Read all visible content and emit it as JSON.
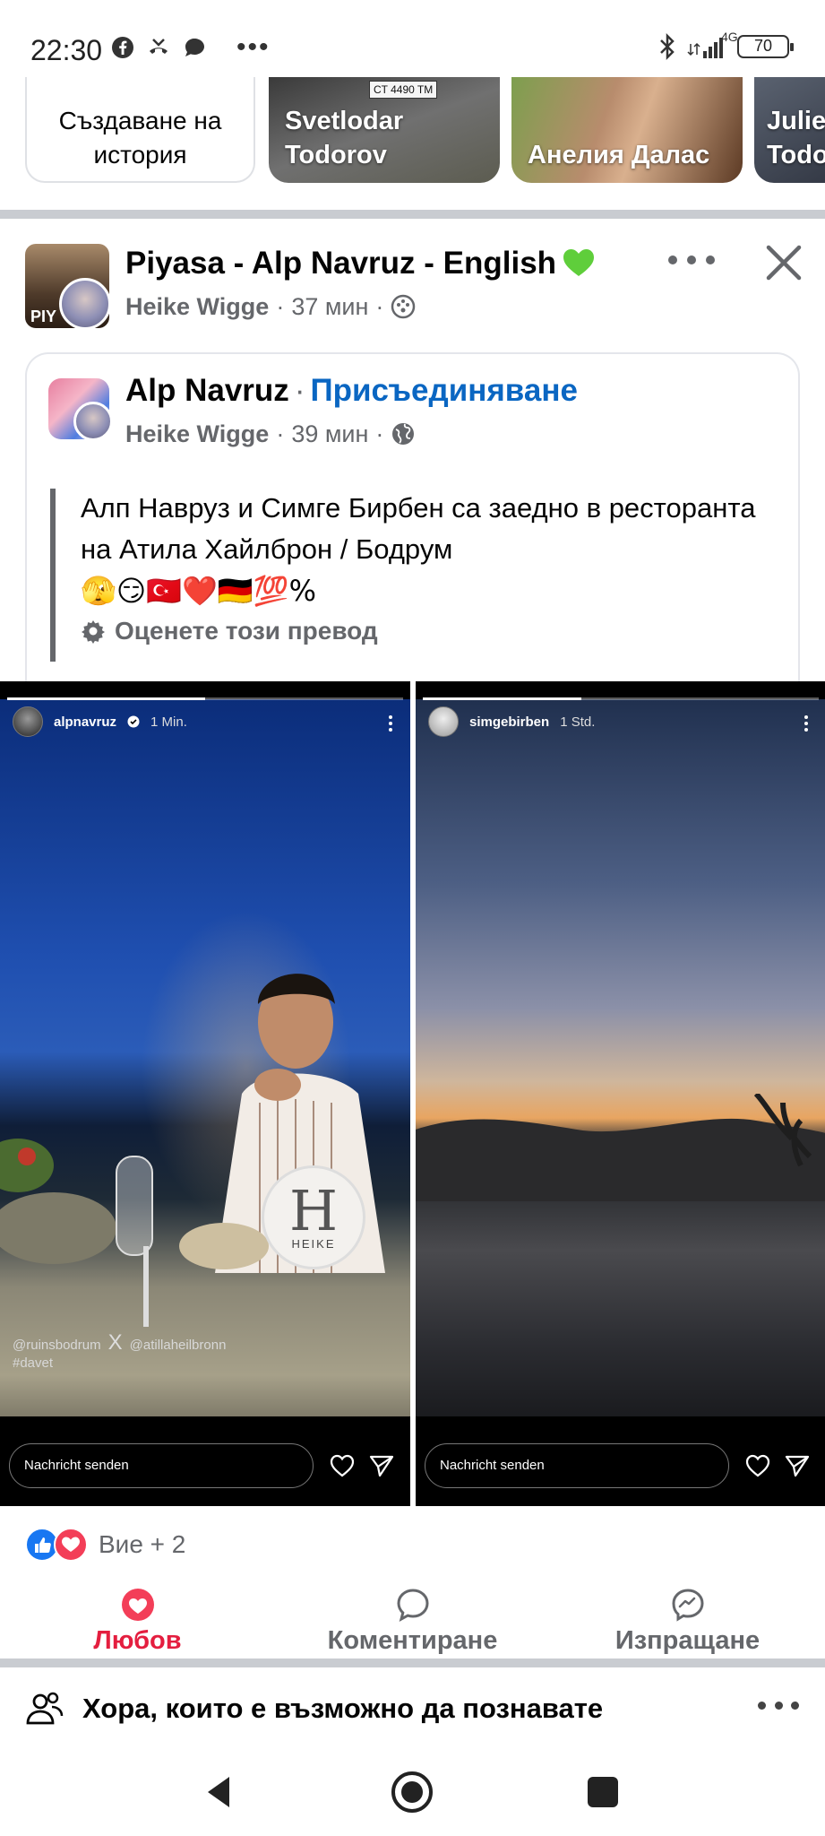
{
  "status_bar": {
    "time": "22:30",
    "network": "4G",
    "battery": "70"
  },
  "stories": {
    "create_label": "Създаване на история",
    "items": [
      {
        "name": "Svetlodar Todorov",
        "plate": "CT 4490 TM"
      },
      {
        "name": "Анелия Далас"
      },
      {
        "name": "Julie Todo"
      }
    ]
  },
  "post": {
    "group_title": "Piyasa - Alp Navruz - English",
    "author": "Heike Wigge",
    "time": "37 мин",
    "avatar_text": "PIY",
    "shared": {
      "page_name": "Alp Navruz",
      "join_label": "Присъединяване",
      "author": "Heike Wigge",
      "time": "39 мин",
      "text": "Алп Навруз и Симге Бирбен са заедно в ресторанта на Атила Хайлброн / Бодрум",
      "emojis": "🫣😏🇹🇷❤️🇩🇪💯%",
      "translate_label": "Оценете този превод"
    },
    "media": {
      "left": {
        "username": "alpnavruz",
        "time": "1 Min.",
        "tag1": "@ruinsbodrum",
        "tag2": "#davet",
        "tag_sep": "X",
        "tag3": "@atillaheilbronn",
        "watermark": "HEIKE",
        "watermark_letter": "H",
        "message_placeholder": "Nachricht senden"
      },
      "right": {
        "username": "simgebirben",
        "time": "1 Std.",
        "message_placeholder": "Nachricht senden"
      }
    },
    "reactions_text": "Вие + 2",
    "actions": {
      "love": "Любов",
      "comment": "Коментиране",
      "share": "Изпращане"
    }
  },
  "suggestions": {
    "title": "Хора, които е възможно да познавате"
  },
  "colors": {
    "facebook_blue": "#0a66c2",
    "love_red": "#e41e3f",
    "secondary_text": "#65676b",
    "divider": "#c9ccd1"
  }
}
